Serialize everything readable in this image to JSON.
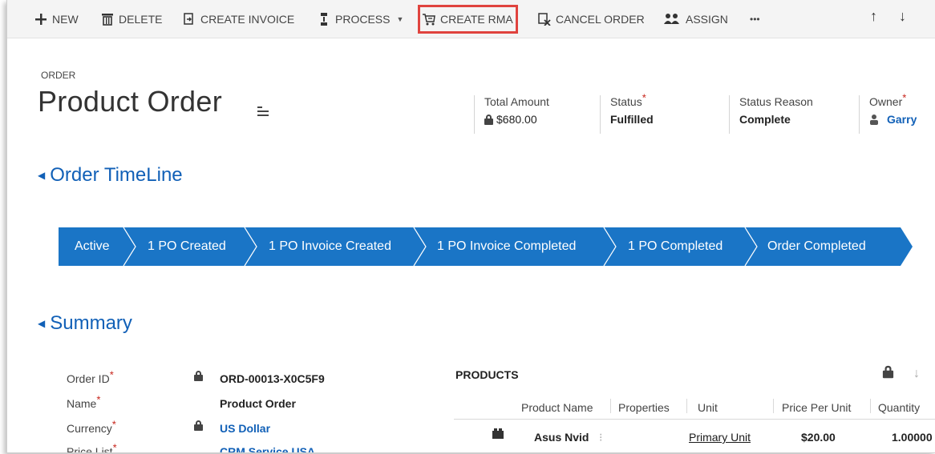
{
  "command_bar": {
    "new": "NEW",
    "delete": "DELETE",
    "create_invoice": "CREATE INVOICE",
    "process": "PROCESS",
    "create_rma": "CREATE RMA",
    "cancel_order": "CANCEL ORDER",
    "assign": "ASSIGN",
    "more": "•••"
  },
  "header": {
    "entity_type": "ORDER",
    "title": "Product Order",
    "fields": [
      {
        "label": "Total Amount",
        "value": "$680.00",
        "required": false,
        "locked": true
      },
      {
        "label": "Status",
        "value": "Fulfilled",
        "required": true
      },
      {
        "label": "Status Reason",
        "value": "Complete",
        "required": false
      },
      {
        "label": "Owner",
        "value": "Garry",
        "required": true
      }
    ]
  },
  "timeline": {
    "title": "Order TimeLine",
    "stages": [
      "Active",
      "1 PO Created",
      "1 PO Invoice Created",
      "1 PO Invoice Completed",
      "1 PO Completed",
      "Order Completed"
    ],
    "color": "#1a75c6"
  },
  "summary": {
    "title": "Summary",
    "fields": [
      {
        "label": "Order ID",
        "value": "ORD-00013-X0C5F9",
        "locked": true
      },
      {
        "label": "Name",
        "value": "Product Order",
        "locked": false
      },
      {
        "label": "Currency",
        "value": "US Dollar",
        "locked": true
      },
      {
        "label": "Price List",
        "value": "CRM Service USA",
        "locked": false
      }
    ]
  },
  "products": {
    "title": "PRODUCTS",
    "columns": [
      "Product Name",
      "Properties",
      "Unit",
      "Price Per Unit",
      "Quantity"
    ],
    "rows": [
      {
        "product_name": "Asus Nvid",
        "properties": "",
        "unit": "Primary Unit",
        "price": "$20.00",
        "quantity": "1.00000"
      }
    ]
  },
  "colors": {
    "accent": "#1160b7",
    "required": "#c7231a",
    "highlight": "#e0433e"
  }
}
